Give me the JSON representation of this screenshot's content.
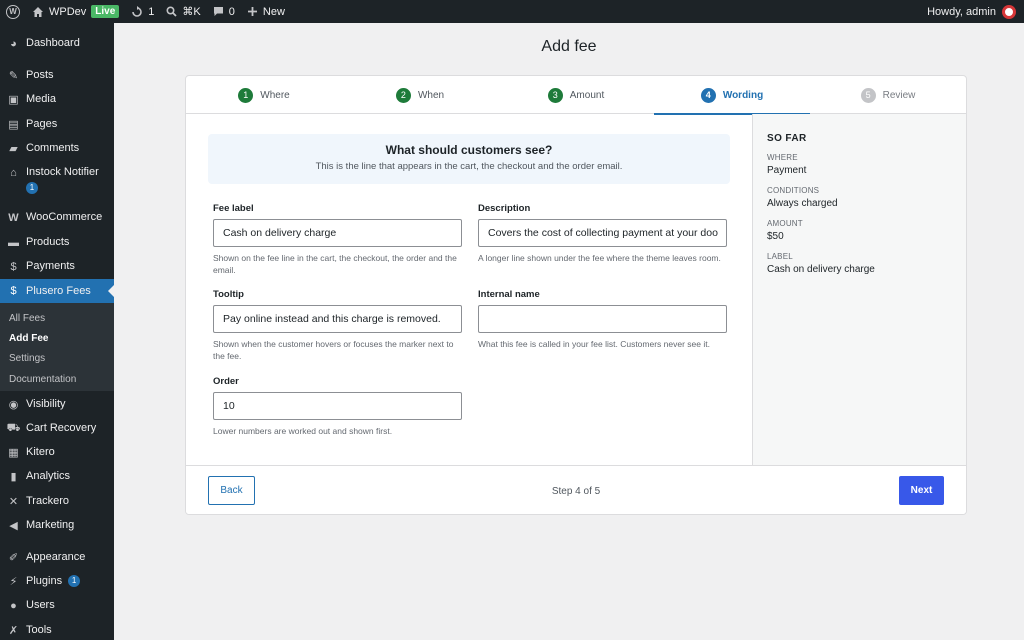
{
  "adminbar": {
    "site_name": "WPDev",
    "live_badge": "Live",
    "updates_count": "1",
    "shortcut": "⌘K",
    "comments_count": "0",
    "new_label": "New",
    "greeting": "Howdy, admin"
  },
  "sidebar": {
    "items": [
      {
        "label": "Dashboard",
        "icon": "dashboard-icon"
      },
      {
        "label": "Posts",
        "icon": "pin-icon"
      },
      {
        "label": "Media",
        "icon": "media-icon"
      },
      {
        "label": "Pages",
        "icon": "page-icon"
      },
      {
        "label": "Comments",
        "icon": "comment-icon"
      },
      {
        "label": "Instock Notifier",
        "icon": "store-icon",
        "badge": "1"
      },
      {
        "label": "WooCommerce",
        "icon": "woo-icon"
      },
      {
        "label": "Products",
        "icon": "archive-icon"
      },
      {
        "label": "Payments",
        "icon": "dollar-box-icon"
      },
      {
        "label": "Plusero Fees",
        "icon": "dollar-circle-icon"
      },
      {
        "label": "Visibility",
        "icon": "eye-icon"
      },
      {
        "label": "Cart Recovery",
        "icon": "cart-icon"
      },
      {
        "label": "Kitero",
        "icon": "grid-icon"
      },
      {
        "label": "Analytics",
        "icon": "bar-chart-icon"
      },
      {
        "label": "Trackero",
        "icon": "cross-arrows-icon"
      },
      {
        "label": "Marketing",
        "icon": "megaphone-icon"
      },
      {
        "label": "Appearance",
        "icon": "brush-icon"
      },
      {
        "label": "Plugins",
        "icon": "plug-icon",
        "badge": "1"
      },
      {
        "label": "Users",
        "icon": "user-icon"
      },
      {
        "label": "Tools",
        "icon": "wrench-icon"
      }
    ],
    "submenu": [
      "All Fees",
      "Add Fee",
      "Settings",
      "Documentation"
    ]
  },
  "page": {
    "title": "Add fee"
  },
  "stepper": {
    "steps": [
      {
        "num": "1",
        "label": "Where"
      },
      {
        "num": "2",
        "label": "When"
      },
      {
        "num": "3",
        "label": "Amount"
      },
      {
        "num": "4",
        "label": "Wording"
      },
      {
        "num": "5",
        "label": "Review"
      }
    ]
  },
  "callout": {
    "title": "What should customers see?",
    "subtitle": "This is the line that appears in the cart, the checkout and the order email."
  },
  "fields": {
    "fee_label": {
      "label": "Fee label",
      "value": "Cash on delivery charge",
      "help": "Shown on the fee line in the cart, the checkout, the order and the email."
    },
    "description": {
      "label": "Description",
      "value": "Covers the cost of collecting payment at your doo",
      "help": "A longer line shown under the fee where the theme leaves room."
    },
    "tooltip": {
      "label": "Tooltip",
      "value": "Pay online instead and this charge is removed.",
      "help": "Shown when the customer hovers or focuses the marker next to the fee."
    },
    "internal_name": {
      "label": "Internal name",
      "value": "",
      "help": "What this fee is called in your fee list. Customers never see it."
    },
    "order": {
      "label": "Order",
      "value": "10",
      "help": "Lower numbers are worked out and shown first."
    }
  },
  "summary": {
    "title": "SO FAR",
    "rows": [
      {
        "key": "WHERE",
        "value": "Payment"
      },
      {
        "key": "CONDITIONS",
        "value": "Always charged"
      },
      {
        "key": "AMOUNT",
        "value": "$50"
      },
      {
        "key": "LABEL",
        "value": "Cash on delivery charge"
      }
    ]
  },
  "footer": {
    "back_label": "Back",
    "step_text": "Step 4 of 5",
    "next_label": "Next"
  },
  "colors": {
    "accent": "#2271b1",
    "primary_button": "#3858e9",
    "complete_step": "#1e7b3a",
    "admin_bar": "#1d2327",
    "live_badge": "#4ab866"
  }
}
